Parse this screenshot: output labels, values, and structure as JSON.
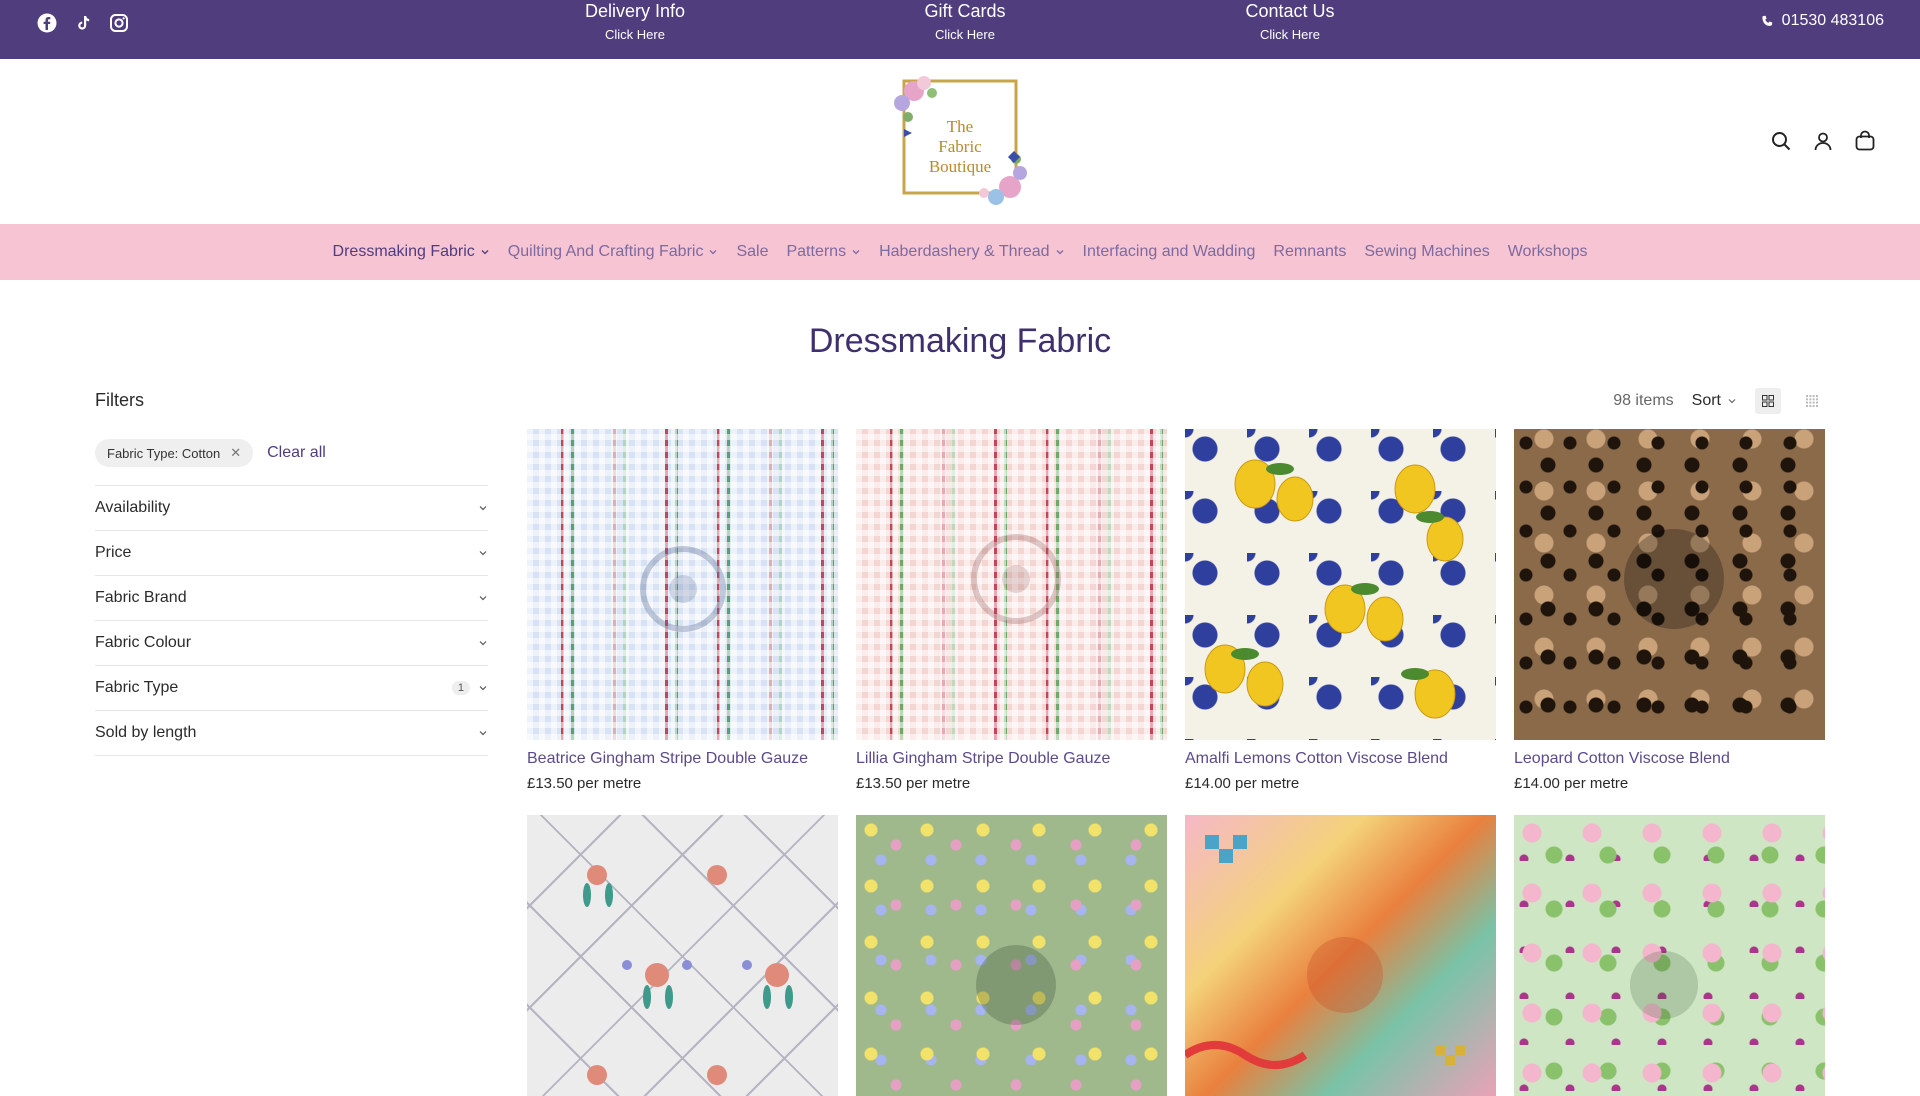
{
  "topbar": {
    "social": [
      "facebook-icon",
      "tiktok-icon",
      "instagram-icon"
    ],
    "promos": [
      {
        "title": "Delivery Info",
        "sub": "Click Here"
      },
      {
        "title": "Gift Cards",
        "sub": "Click Here"
      },
      {
        "title": "Contact Us",
        "sub": "Click Here"
      }
    ],
    "phone": "01530 483106",
    "bg": "#4f3d7e"
  },
  "logo": {
    "line1": "The",
    "line2": "Fabric",
    "line3": "Boutique"
  },
  "nav": {
    "items": [
      {
        "label": "Dressmaking Fabric",
        "dropdown": true
      },
      {
        "label": "Quilting And Crafting Fabric",
        "dropdown": true
      },
      {
        "label": "Sale",
        "dropdown": false
      },
      {
        "label": "Patterns",
        "dropdown": true
      },
      {
        "label": "Haberdashery & Thread",
        "dropdown": true
      },
      {
        "label": "Interfacing and Wadding",
        "dropdown": false
      },
      {
        "label": "Remnants",
        "dropdown": false
      },
      {
        "label": "Sewing Machines",
        "dropdown": false
      },
      {
        "label": "Workshops",
        "dropdown": false
      }
    ],
    "bg": "#f6c4d3"
  },
  "page": {
    "title": "Dressmaking Fabric"
  },
  "filters": {
    "title": "Filters",
    "active": [
      {
        "label": "Fabric Type: Cotton"
      }
    ],
    "clear_all": "Clear all",
    "facets": [
      {
        "label": "Availability",
        "count": ""
      },
      {
        "label": "Price",
        "count": ""
      },
      {
        "label": "Fabric Brand",
        "count": ""
      },
      {
        "label": "Fabric Colour",
        "count": ""
      },
      {
        "label": "Fabric Type",
        "count": "1"
      },
      {
        "label": "Sold by length",
        "count": ""
      }
    ]
  },
  "toolbar": {
    "count": "98 items",
    "sort": "Sort"
  },
  "products": [
    {
      "name": "Beatrice Gingham Stripe Double Gauze",
      "price": "£13.50 per metre"
    },
    {
      "name": "Lillia Gingham Stripe Double Gauze",
      "price": "£13.50 per metre"
    },
    {
      "name": "Amalfi Lemons Cotton Viscose Blend",
      "price": "£14.00 per metre"
    },
    {
      "name": "Leopard Cotton Viscose Blend",
      "price": "£14.00 per metre"
    },
    {
      "name": "",
      "price": ""
    },
    {
      "name": "",
      "price": ""
    },
    {
      "name": "",
      "price": ""
    },
    {
      "name": "",
      "price": ""
    }
  ]
}
